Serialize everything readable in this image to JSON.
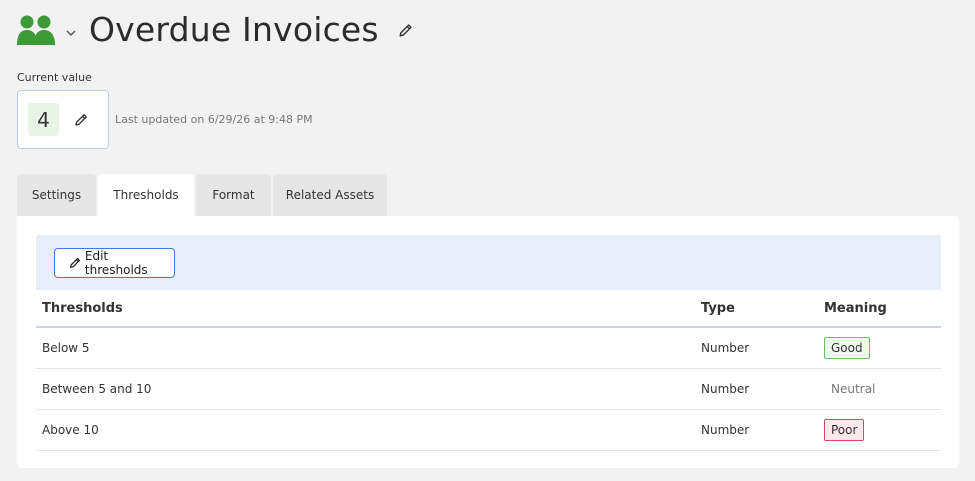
{
  "header": {
    "title": "Overdue Invoices"
  },
  "current_value": {
    "label": "Current value",
    "value": "4",
    "last_updated": "Last updated on 6/29/26 at 9:48 PM"
  },
  "tabs": [
    {
      "label": "Settings",
      "active": false
    },
    {
      "label": "Thresholds",
      "active": true
    },
    {
      "label": "Format",
      "active": false
    },
    {
      "label": "Related Assets",
      "active": false
    }
  ],
  "toolbar": {
    "edit_label": "Edit thresholds"
  },
  "table": {
    "columns": [
      "Thresholds",
      "Type",
      "Meaning"
    ],
    "rows": [
      {
        "threshold": "Below 5",
        "type": "Number",
        "meaning": "Good"
      },
      {
        "threshold": "Between 5 and 10",
        "type": "Number",
        "meaning": "Neutral"
      },
      {
        "threshold": "Above 10",
        "type": "Number",
        "meaning": "Poor"
      }
    ]
  },
  "colors": {
    "brand_green": "#3e9a36",
    "accent_blue": "#3b7dd8",
    "good": "#6cc063",
    "poor": "#d8456b"
  },
  "icons": [
    "people-group-icon",
    "chevron-down-icon",
    "pencil-icon"
  ]
}
